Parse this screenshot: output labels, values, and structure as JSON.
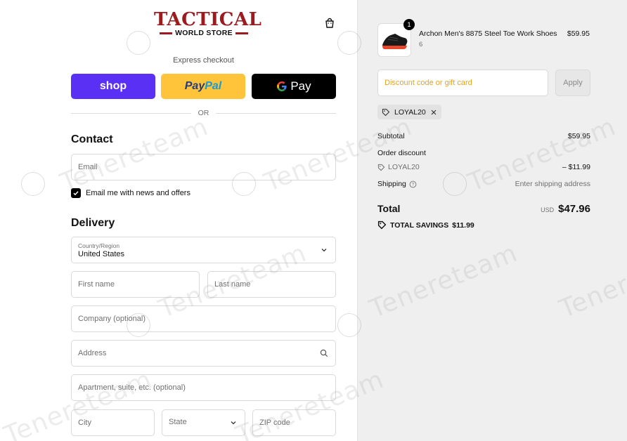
{
  "brand": {
    "logo_main": "TACTICAL",
    "logo_sub": "WORLD STORE"
  },
  "express": {
    "label": "Express checkout",
    "shop_label": "shop",
    "paypal_part1": "Pay",
    "paypal_part2": "Pal",
    "gpay_g": "G",
    "gpay_label": "Pay",
    "or_label": "OR"
  },
  "contact": {
    "title": "Contact",
    "email_placeholder": "Email",
    "newsletter_label": "Email me with news and offers",
    "newsletter_checked": true
  },
  "delivery": {
    "title": "Delivery",
    "country_label": "Country/Region",
    "country_value": "United States",
    "first_name_placeholder": "First name",
    "last_name_placeholder": "Last name",
    "company_placeholder": "Company (optional)",
    "address_placeholder": "Address",
    "apartment_placeholder": "Apartment, suite, etc. (optional)",
    "city_placeholder": "City",
    "state_placeholder": "State",
    "zip_placeholder": "ZIP code"
  },
  "order": {
    "product": {
      "name": "Archon Men's 8875 Steel Toe Work Shoes",
      "variant": "6",
      "price": "$59.95",
      "quantity": "1"
    },
    "discount_placeholder": "Discount code or gift card",
    "apply_label": "Apply",
    "applied_code": "LOYAL20",
    "subtotal_label": "Subtotal",
    "subtotal_value": "$59.95",
    "order_discount_label": "Order discount",
    "discount_code": "LOYAL20",
    "discount_value": "– $11.99",
    "shipping_label": "Shipping",
    "shipping_value": "Enter shipping address",
    "total_label": "Total",
    "currency": "USD",
    "total_value": "$47.96",
    "savings_label": "TOTAL SAVINGS",
    "savings_value": "$11.99"
  },
  "watermark": {
    "text": "Tenereteam"
  },
  "colors": {
    "brand_red": "#9b1b1f",
    "shop_purple": "#5a31f4",
    "paypal_yellow": "#ffc439",
    "discount_placeholder": "#e8a317",
    "right_panel_bg": "#f0eff0"
  }
}
